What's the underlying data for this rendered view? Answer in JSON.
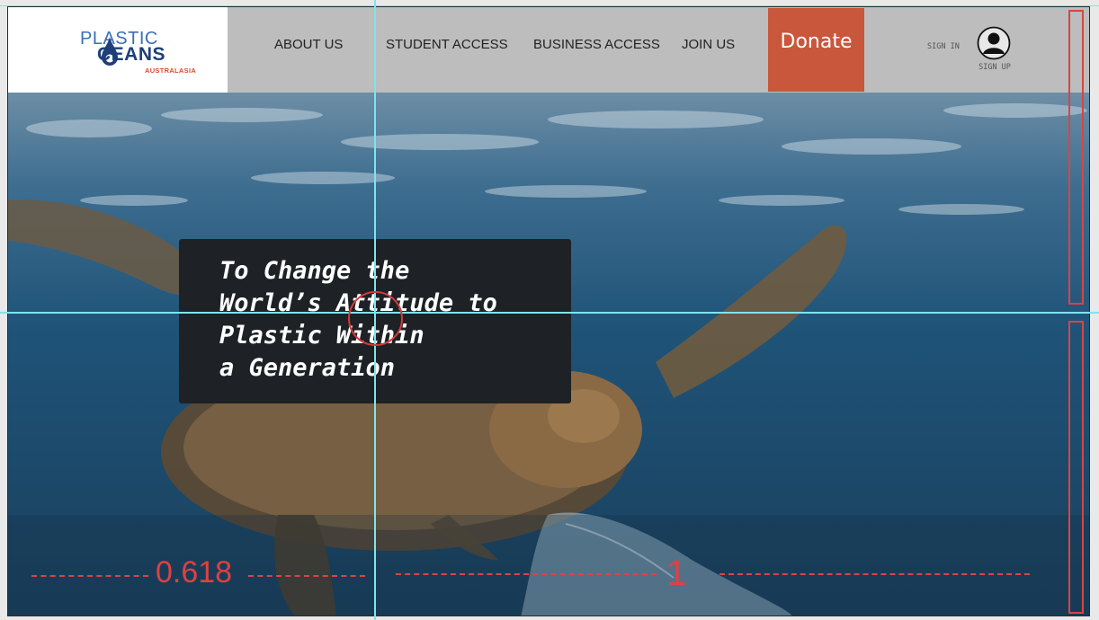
{
  "logo": {
    "line1": "PLASTIC",
    "line2": "CEANS",
    "line3": "AUSTRALASIA"
  },
  "nav": {
    "items": [
      {
        "label": "ABOUT US"
      },
      {
        "label": "STUDENT ACCESS"
      },
      {
        "label": "BUSINESS ACCESS"
      },
      {
        "label": "JOIN US"
      }
    ],
    "donate_label": "Donate",
    "sign_in_label": "SIGN IN",
    "sign_up_label": "SIGN UP"
  },
  "hero": {
    "headline_lines": [
      "To Change the",
      "World’s Attitude to",
      "Plastic Within",
      "a Generation"
    ]
  },
  "overlay": {
    "left_ratio": "0.618",
    "right_ratio": "1"
  },
  "colors": {
    "header_bg": "#bcbdbc",
    "donate_bg": "#c9573b",
    "headline_box": "#1e2126",
    "guide_line": "#7fe4ef",
    "annotation_red": "#e04040"
  }
}
